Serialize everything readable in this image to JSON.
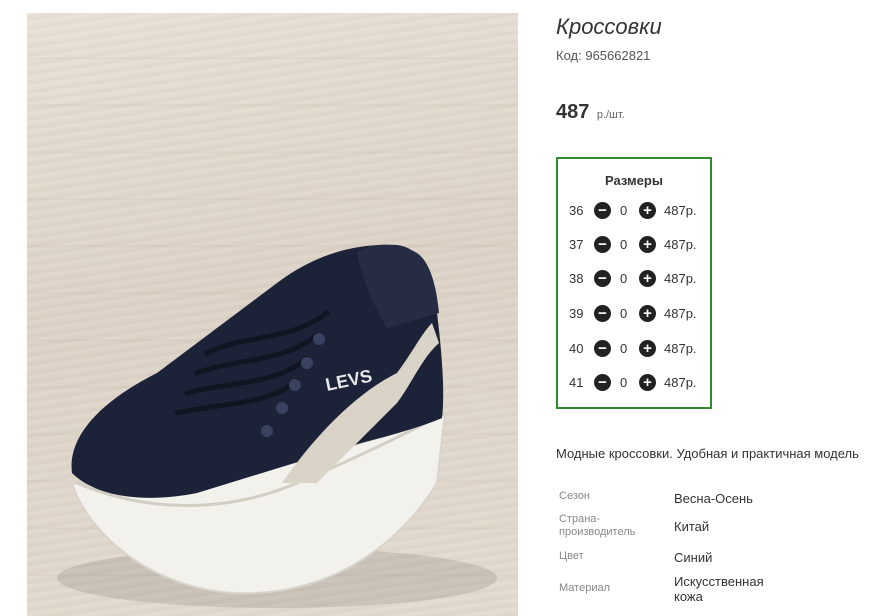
{
  "product": {
    "title": "Кроссовки",
    "code_label": "Код:",
    "code_value": "965662821",
    "price_value": "487",
    "price_unit": "р./шт."
  },
  "sizes": {
    "title": "Размеры",
    "minus_icon": "minus-circle-icon",
    "plus_icon": "plus-circle-icon",
    "rows": [
      {
        "size": "36",
        "qty": "0",
        "price": "487р."
      },
      {
        "size": "37",
        "qty": "0",
        "price": "487р."
      },
      {
        "size": "38",
        "qty": "0",
        "price": "487р."
      },
      {
        "size": "39",
        "qty": "0",
        "price": "487р."
      },
      {
        "size": "40",
        "qty": "0",
        "price": "487р."
      },
      {
        "size": "41",
        "qty": "0",
        "price": "487р."
      }
    ]
  },
  "description": "Модные кроссовки. Удобная и практичная модель",
  "attributes": [
    {
      "key": "Сезон",
      "value": "Весна-Осень"
    },
    {
      "key": "Страна-\nпроизводитель",
      "value": "Китай"
    },
    {
      "key": "Цвет",
      "value": "Синий"
    },
    {
      "key": "Материал",
      "value": "Искусственная\nкожа"
    }
  ],
  "photo": {
    "shoe_logo_text": "LEVS"
  },
  "colors": {
    "sizes_border": "#2e8b2e",
    "shoe_upper": "#1c2238",
    "shoe_sole": "#f3f1ec",
    "shoe_stripe": "#d9d3c8"
  }
}
